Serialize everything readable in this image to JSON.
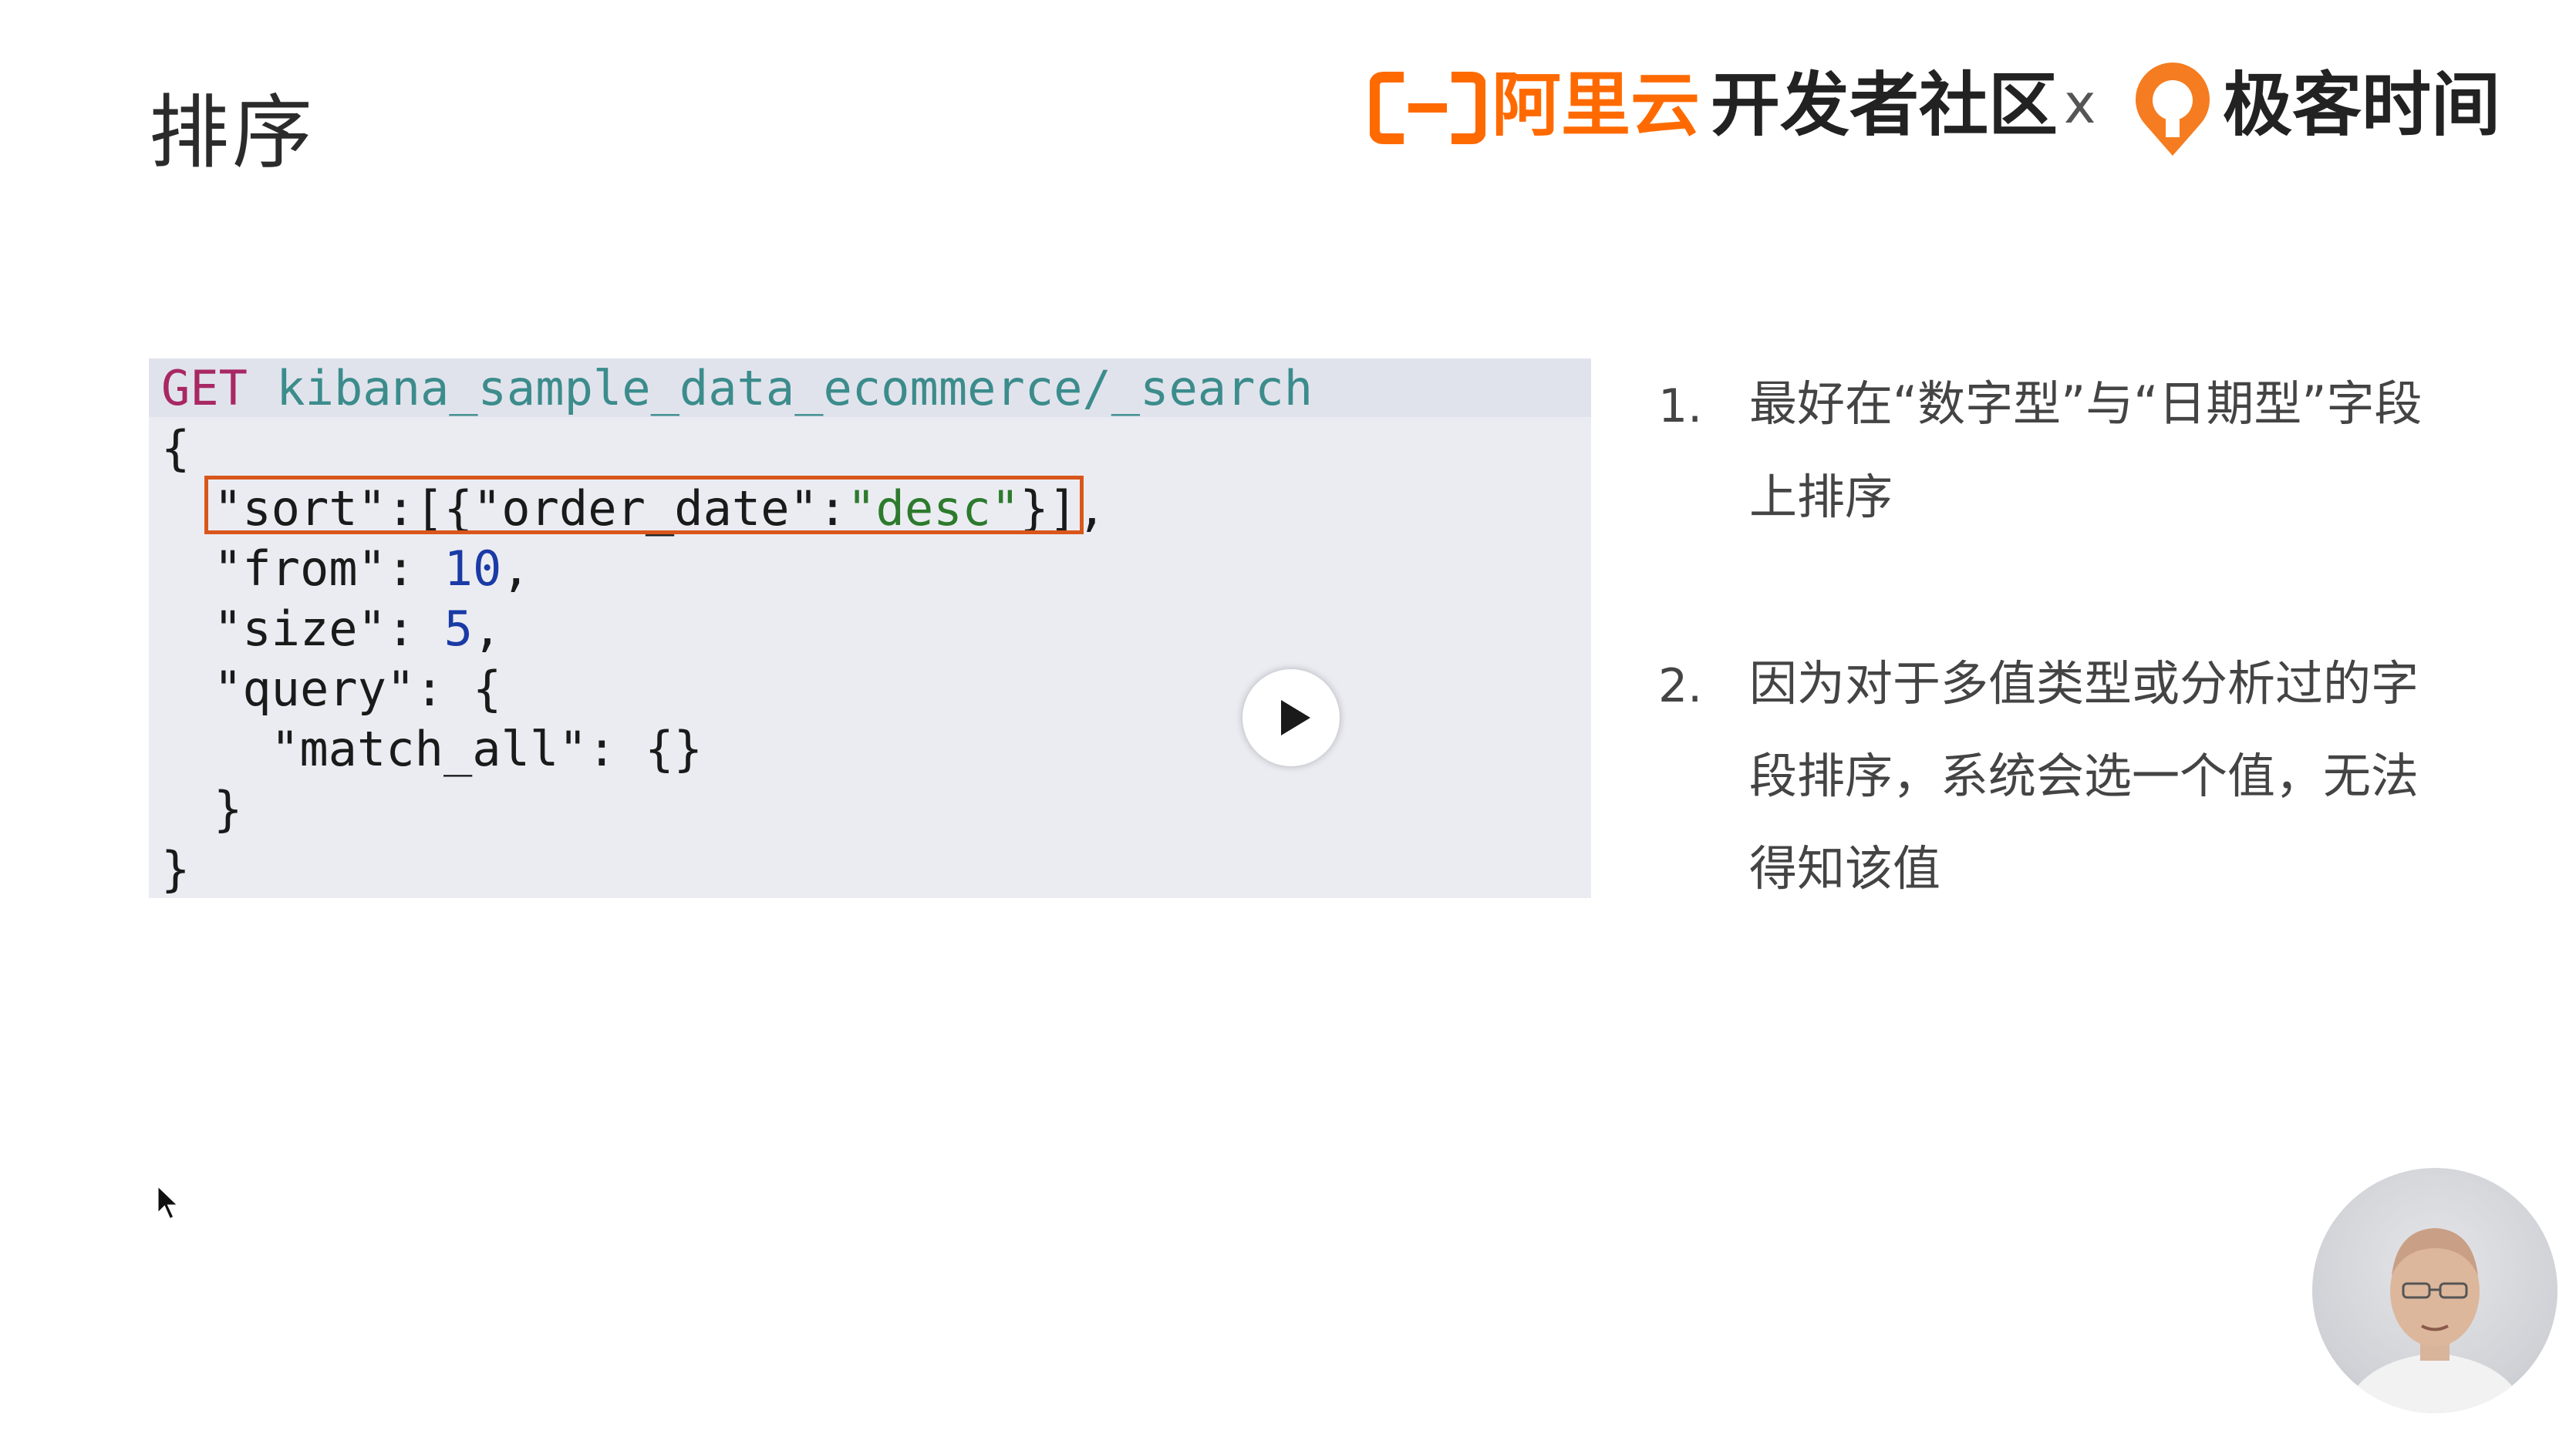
{
  "slide": {
    "title": "排序"
  },
  "header": {
    "aliyun_text": "阿里云",
    "community_text": "开发者社区",
    "times_sign": "x",
    "geek_text": "极客时间"
  },
  "code": {
    "line1": {
      "method": "GET",
      "path": " kibana_sample_data_ecommerce/_search"
    },
    "line2": "{",
    "line3": {
      "k1": "\"sort\"",
      "p1": ":[{",
      "k2": "\"order_date\"",
      "p2": ":",
      "v": "\"desc\"",
      "p3": "}],"
    },
    "line4": {
      "k": "\"from\"",
      "p": ": ",
      "v": "10",
      "t": ","
    },
    "line5": {
      "k": "\"size\"",
      "p": ": ",
      "v": "5",
      "t": ","
    },
    "line6": {
      "k": "\"query\"",
      "p": ": {"
    },
    "line7": {
      "k": "\"match_all\"",
      "p": ": {}"
    },
    "line8": "}",
    "line9": "}"
  },
  "notes": {
    "n1_num": "1.",
    "n1_line1": "最好在“数字型”与“日期型”字段",
    "n1_line2": "上排序",
    "n2_num": "2.",
    "n2_line1": "因为对于多值类型或分析过的字",
    "n2_line2": "段排序，系统会选一个值，无法",
    "n2_line3": "得知该值"
  },
  "colors": {
    "aliyun_orange": "#ff6a00",
    "highlight_border": "#d9561b",
    "code_bg": "#ebecf2"
  },
  "icons": {
    "play": "play-icon",
    "cursor": "mouse-pointer-icon"
  }
}
